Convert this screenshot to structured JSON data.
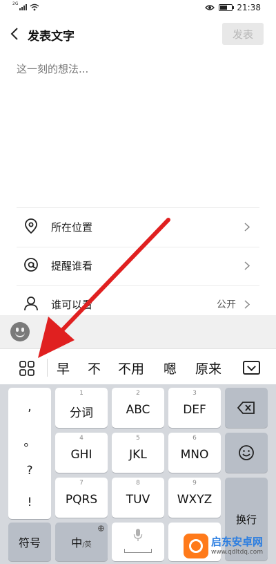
{
  "status_bar": {
    "network": "2G",
    "time": "21:38",
    "battery_level": 0.6
  },
  "header": {
    "title": "发表文字",
    "post_label": "发表"
  },
  "compose": {
    "placeholder": "这一刻的想法..."
  },
  "options": [
    {
      "label": "所在位置",
      "value": "",
      "icon": "location-pin-icon"
    },
    {
      "label": "提醒谁看",
      "value": "",
      "icon": "at-sign-icon"
    },
    {
      "label": "谁可以看",
      "value": "公开",
      "icon": "person-icon"
    }
  ],
  "emoji_bar": {
    "icon": "emoji-icon"
  },
  "candidates": {
    "menu_icon": "grid-menu-icon",
    "items": [
      "早",
      "不",
      "不用",
      "嗯",
      "原来"
    ],
    "collapse_icon": "keyboard-collapse-icon"
  },
  "keyboard": {
    "punctuation": [
      ",",
      "。",
      "?",
      "!"
    ],
    "keys": [
      {
        "num": "1",
        "label": "分词"
      },
      {
        "num": "2",
        "label": "ABC"
      },
      {
        "num": "3",
        "label": "DEF"
      },
      {
        "num": "4",
        "label": "GHI"
      },
      {
        "num": "5",
        "label": "JKL"
      },
      {
        "num": "6",
        "label": "MNO"
      },
      {
        "num": "7",
        "label": "PQRS"
      },
      {
        "num": "8",
        "label": "TUV"
      },
      {
        "num": "9",
        "label": "WXYZ"
      }
    ],
    "symbols_label": "符号",
    "lang_label": "中",
    "lang_sub": "/英",
    "enter_label": "换行",
    "backspace_icon": "backspace-icon",
    "smiley_icon": "smiley-icon",
    "mic_icon": "microphone-icon"
  },
  "watermark": {
    "title": "启东安卓网",
    "url": "www.qdltdq.com"
  },
  "colors": {
    "annotation_arrow": "#e02020",
    "post_button_bg": "#e8e8e8",
    "keyboard_bg": "#d5d8dd",
    "watermark_brand": "#2a7de1"
  }
}
